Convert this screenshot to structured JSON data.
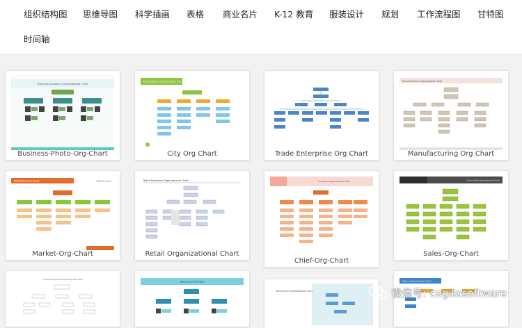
{
  "tabs": [
    {
      "label": "组织结构图"
    },
    {
      "label": "思维导图"
    },
    {
      "label": "科学插画"
    },
    {
      "label": "表格"
    },
    {
      "label": "商业名片"
    },
    {
      "label": "K-12 教育"
    },
    {
      "label": "服装设计"
    },
    {
      "label": "规划"
    },
    {
      "label": "工作流程图"
    },
    {
      "label": "甘特图"
    },
    {
      "label": "时间轴"
    }
  ],
  "templates": [
    {
      "caption": "Business-Photo-Org-Chart",
      "thumb_title": "Business Company Organizational Chart"
    },
    {
      "caption": "City Org Chart",
      "thumb_title": "Organizational Chart of Green City Team"
    },
    {
      "caption": "Trade Enterprise Org Chart"
    },
    {
      "caption": "Manufacturing Org Chart",
      "thumb_title": "Manufacturing Organizational Chart"
    },
    {
      "caption": "Market-Org-Chart",
      "thumb_title": "Marketing Department",
      "thumb_brand": "Title/Company"
    },
    {
      "caption": "Retail Organizational Chart",
      "thumb_title": "Retail Enterprise Organizational Chart"
    },
    {
      "caption": "Chief-Org-Chart",
      "thumb_title": "Company Organizational Chart"
    },
    {
      "caption": "Sales-Org-Chart",
      "thumb_title": "Sound Sales Organizational Chart"
    },
    {
      "caption": "",
      "thumb_title": "Functional Service Reporting Structure"
    },
    {
      "caption": "",
      "thumb_title": "Insert your title here"
    },
    {
      "caption": "",
      "thumb_title": "Hierarchical Organizational Chart"
    },
    {
      "caption": "",
      "thumb_title": "Matrix Organizational Chart"
    }
  ],
  "watermark": {
    "text": "微信号: cogitosoftware",
    "icon": "wechat-icon"
  },
  "colors": {
    "tabs_background": "#ffffff",
    "page_background": "#f2f2f2",
    "teal": "#5fc7c4",
    "green": "#8cc63e",
    "blue": "#5b9bd5",
    "orange": "#e46c2a",
    "olive": "#9ac53b"
  }
}
